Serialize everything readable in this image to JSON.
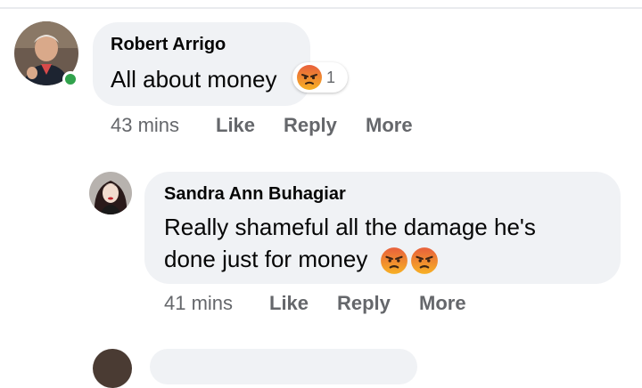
{
  "comments": [
    {
      "author": "Robert Arrigo",
      "text": "All about money",
      "reaction": {
        "emoji": "angry-face-icon",
        "count": "1"
      },
      "time": "43 mins",
      "actions": {
        "like": "Like",
        "reply": "Reply",
        "more": "More"
      },
      "online": true
    },
    {
      "author": "Sandra Ann Buhagiar",
      "text_line1": "Really shameful all the damage he's",
      "text_line2": "done just for money",
      "emojis": [
        "angry-face-icon",
        "angry-face-icon"
      ],
      "time": "41 mins",
      "actions": {
        "like": "Like",
        "reply": "Reply",
        "more": "More"
      }
    }
  ],
  "colors": {
    "bubble": "#f0f2f5",
    "meta_text": "#65676b",
    "online": "#31a24c",
    "angry_top": "#e8603c",
    "angry_bottom": "#f7b125"
  }
}
